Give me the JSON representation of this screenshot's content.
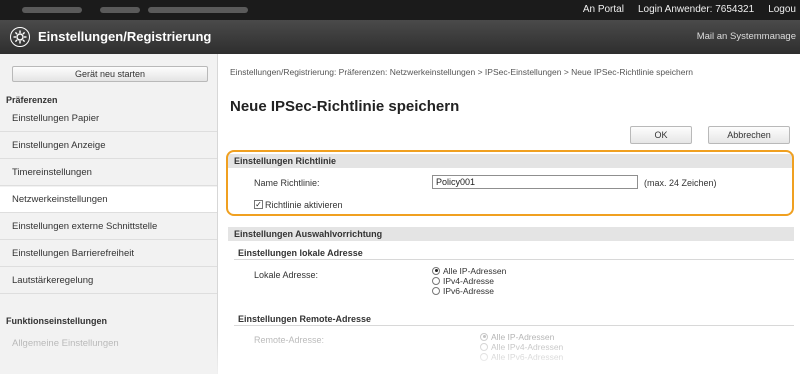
{
  "topbar": {
    "portal_link": "An Portal",
    "login_user": "Login Anwender:",
    "user_id": "7654321",
    "logout": "Logou"
  },
  "header": {
    "title": "Einstellungen/Registrierung",
    "mail_link": "Mail an Systemmanage",
    "logo_icon": "settings-gear-icon"
  },
  "sidebar": {
    "restart_button": "Gerät neu starten",
    "section_preferences": "Präferenzen",
    "items": [
      {
        "label": "Einstellungen Papier"
      },
      {
        "label": "Einstellungen Anzeige"
      },
      {
        "label": "Timereinstellungen"
      },
      {
        "label": "Netzwerkeinstellungen"
      },
      {
        "label": "Einstellungen externe Schnittstelle"
      },
      {
        "label": "Einstellungen Barrierefreiheit"
      },
      {
        "label": "Lautstärkeregelung"
      }
    ],
    "section_functions": "Funktionseinstellungen",
    "function_items": [
      {
        "label": "Allgemeine Einstellungen"
      }
    ]
  },
  "main": {
    "breadcrumb": "Einstellungen/Registrierung: Präferenzen: Netzwerkeinstellungen > IPSec-Einstellungen > Neue IPSec-Richtlinie speichern",
    "page_title": "Neue IPSec-Richtlinie speichern",
    "ok_button": "OK",
    "cancel_button": "Abbrechen",
    "policy_settings": {
      "heading": "Einstellungen Richtlinie",
      "name_label": "Name Richtlinie:",
      "name_value": "Policy001",
      "name_hint": "(max. 24 Zeichen)",
      "activate_label": "Richtlinie aktivieren",
      "activate_checked": true
    },
    "selector_settings": {
      "heading": "Einstellungen Auswahlvorrichtung",
      "local": {
        "heading": "Einstellungen lokale Adresse",
        "label": "Lokale Adresse:",
        "options": [
          "Alle IP-Adressen",
          "IPv4-Adresse",
          "IPv6-Adresse"
        ],
        "selected": "Alle IP-Adressen"
      },
      "remote": {
        "heading": "Einstellungen Remote-Adresse",
        "label": "Remote-Adresse:",
        "options": [
          "Alle IP-Adressen",
          "Alle IPv4-Adressen",
          "Alle IPv6-Adressen"
        ],
        "selected": "Alle IP-Adressen"
      }
    }
  },
  "colors": {
    "highlight": "#f0a020",
    "topbar": "#1b1b1b",
    "header": "#3a3a3a"
  }
}
